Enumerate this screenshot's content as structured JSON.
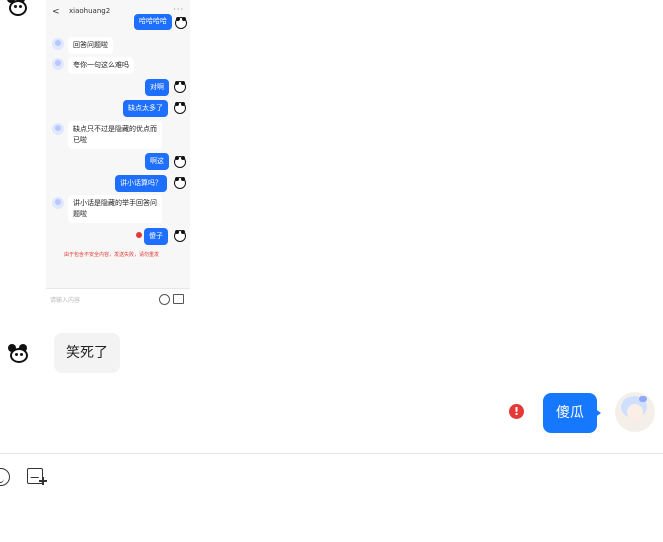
{
  "embedded_screenshot": {
    "header": {
      "back": "<",
      "title": "xiaohuang2",
      "more": "···"
    },
    "top_sent_bubble": "哈哈哈哈",
    "messages": [
      {
        "side": "in",
        "text": "回答问题啦"
      },
      {
        "side": "in",
        "text": "夸你一句这么难吗"
      },
      {
        "side": "out",
        "text": "对啊"
      },
      {
        "side": "out",
        "text": "缺点太多了"
      },
      {
        "side": "in",
        "text": "缺点只不过是隐藏的优点而已啦"
      },
      {
        "side": "out",
        "text": "啊这"
      },
      {
        "side": "out",
        "text": "讲小话算吗？"
      },
      {
        "side": "in",
        "text": "讲小话是隐藏的举手回答问题啦"
      },
      {
        "side": "out",
        "text": "傻子",
        "failed": true
      }
    ],
    "notice": "由于包含不安全内容，发送失败，请勿重发",
    "input_placeholder": "请输入内容"
  },
  "chat": {
    "incoming_message": "笑死了",
    "outgoing_message": "傻瓜",
    "outgoing_failed_icon": "!"
  },
  "icons": {
    "emoji": "smile-icon",
    "image": "add-image-icon",
    "error": "error-icon"
  },
  "colors": {
    "accent_blue": "#1677ff",
    "error_red": "#e53935",
    "incoming_bg": "#f3f3f3"
  }
}
